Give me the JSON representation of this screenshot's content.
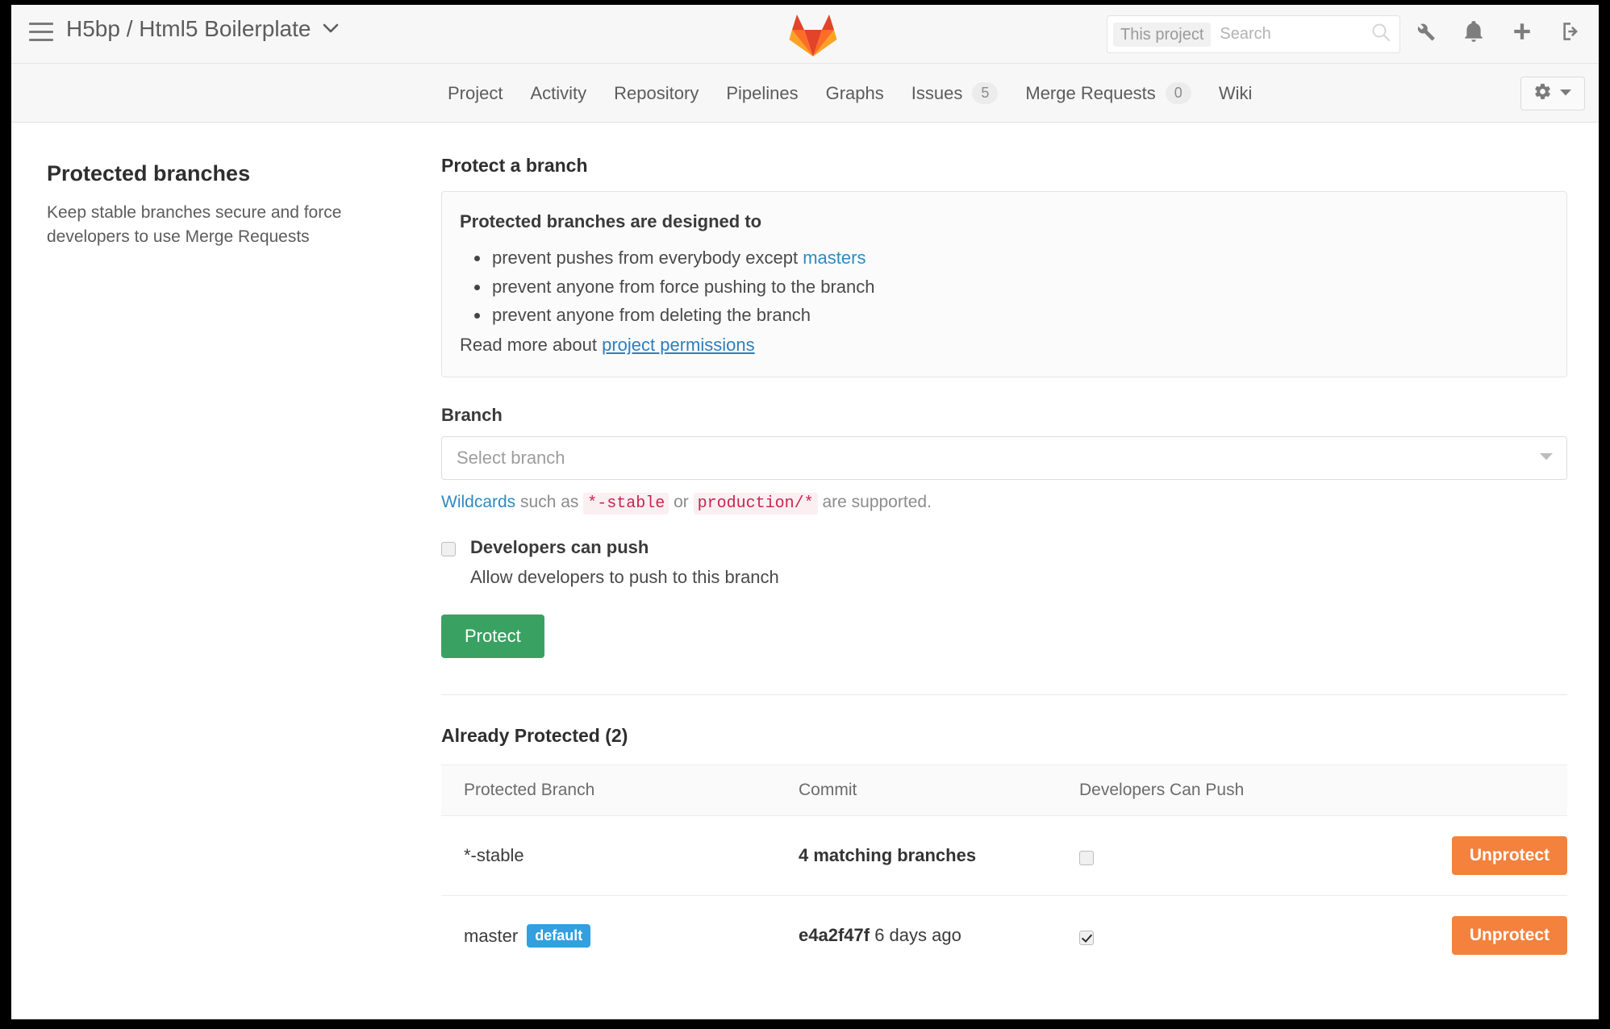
{
  "header": {
    "menu_icon": "hamburger-icon",
    "project_breadcrumb": "H5bp / Html5 Boilerplate",
    "logo_icon": "gitlab-logo",
    "search": {
      "scope_label": "This project",
      "placeholder": "Search",
      "value": "",
      "icon": "search-icon"
    },
    "icons": [
      {
        "name": "wrench-icon",
        "label": "Admin area"
      },
      {
        "name": "bell-icon",
        "label": "Todos"
      },
      {
        "name": "plus-icon",
        "label": "New"
      },
      {
        "name": "sign-out-icon",
        "label": "Sign out"
      }
    ]
  },
  "nav": {
    "items": [
      {
        "label": "Project",
        "badge": null
      },
      {
        "label": "Activity",
        "badge": null
      },
      {
        "label": "Repository",
        "badge": null
      },
      {
        "label": "Pipelines",
        "badge": null
      },
      {
        "label": "Graphs",
        "badge": null
      },
      {
        "label": "Issues",
        "badge": "5"
      },
      {
        "label": "Merge Requests",
        "badge": "0"
      },
      {
        "label": "Wiki",
        "badge": null
      }
    ],
    "settings_icon": "gear-icon",
    "settings_caret_icon": "chevron-down-icon"
  },
  "sidebar": {
    "title": "Protected branches",
    "description": "Keep stable branches secure and force developers to use Merge Requests"
  },
  "main": {
    "protect_section_title": "Protect a branch",
    "info": {
      "heading": "Protected branches are designed to",
      "bullets": [
        {
          "pre": "prevent pushes from everybody except ",
          "link": "masters",
          "post": ""
        },
        {
          "pre": "prevent anyone from force pushing to the branch",
          "link": null,
          "post": ""
        },
        {
          "pre": "prevent anyone from deleting the branch",
          "link": null,
          "post": ""
        }
      ],
      "read_more_prefix": "Read more about ",
      "read_more_link": "project permissions"
    },
    "branch_field": {
      "label": "Branch",
      "placeholder": "Select branch",
      "value": "",
      "caret_icon": "chevron-down-icon"
    },
    "wildcards_help": {
      "link": "Wildcards",
      "text_1": " such as ",
      "code_1": "*-stable",
      "text_2": " or ",
      "code_2": "production/*",
      "text_3": " are supported."
    },
    "developers_push": {
      "checked": false,
      "title": "Developers can push",
      "subtitle": "Allow developers to push to this branch"
    },
    "protect_button": "Protect",
    "table": {
      "title": "Already Protected (2)",
      "columns": [
        "Protected Branch",
        "Commit",
        "Developers Can Push",
        ""
      ],
      "rows": [
        {
          "branch": "*-stable",
          "badge": null,
          "commit_sha": "4 matching branches",
          "commit_when": "",
          "commit_is_matching_text": true,
          "can_push": false,
          "action_label": "Unprotect"
        },
        {
          "branch": "master",
          "badge": "default",
          "commit_sha": "e4a2f47f",
          "commit_when": " 6 days ago",
          "commit_is_matching_text": false,
          "can_push": true,
          "action_label": "Unprotect"
        }
      ]
    }
  },
  "colors": {
    "brand_orange": "#f4813c",
    "success_green": "#39a262",
    "link_blue": "#2f8ac1",
    "badge_blue": "#32a0e0",
    "code_red": "#c7254e"
  }
}
